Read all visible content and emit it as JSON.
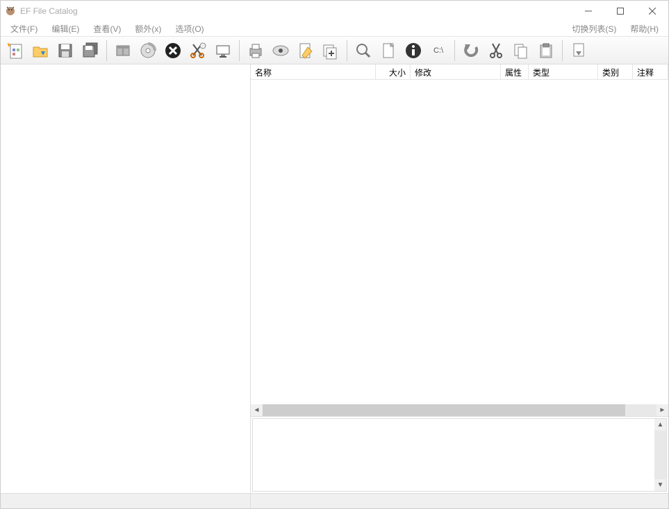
{
  "window": {
    "title": "EF File Catalog"
  },
  "menu": {
    "file": "文件(F)",
    "edit": "编辑(E)",
    "view": "查看(V)",
    "extra": "额外(x)",
    "options": "选项(O)",
    "switch_list": "切换列表(S)",
    "help": "帮助(H)"
  },
  "toolbar": {
    "new_catalog": "new-catalog",
    "open_folder": "open-folder",
    "save": "save",
    "save_all": "save-all",
    "archive": "archive",
    "disc": "disc",
    "cancel": "cancel",
    "cut": "cut",
    "screen": "screen",
    "print": "print",
    "preview": "preview",
    "edit": "edit",
    "add_folder": "add-folder",
    "search": "search",
    "page": "page",
    "info": "info",
    "path": "path",
    "path_text": "C:\\",
    "undo": "undo",
    "scissors": "scissors",
    "copy": "copy",
    "paste": "paste",
    "download": "download"
  },
  "columns": {
    "name": "名称",
    "size": "大小",
    "modify": "修改",
    "attr": "属性",
    "type": "类型",
    "cat": "类别",
    "note": "注释"
  }
}
